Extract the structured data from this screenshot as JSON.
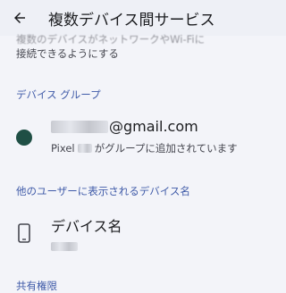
{
  "header": {
    "title": "複数デバイス間サービス"
  },
  "description": {
    "line1": "複数のデバイスがネットワークやWi-Fiに",
    "line2": "接続できるようにする"
  },
  "sections": {
    "device_group": "デバイス グループ",
    "visible_name": "他のユーザーに表示されるデバイス名",
    "shared_section": "共有権限"
  },
  "account": {
    "email_suffix": "@gmail.com",
    "sub_prefix": "Pixel",
    "sub_suffix": "がグループに追加されています"
  },
  "device": {
    "title": "デバイス名"
  },
  "colors": {
    "accent": "#3f5aa8",
    "avatar": "#1f4f45"
  }
}
